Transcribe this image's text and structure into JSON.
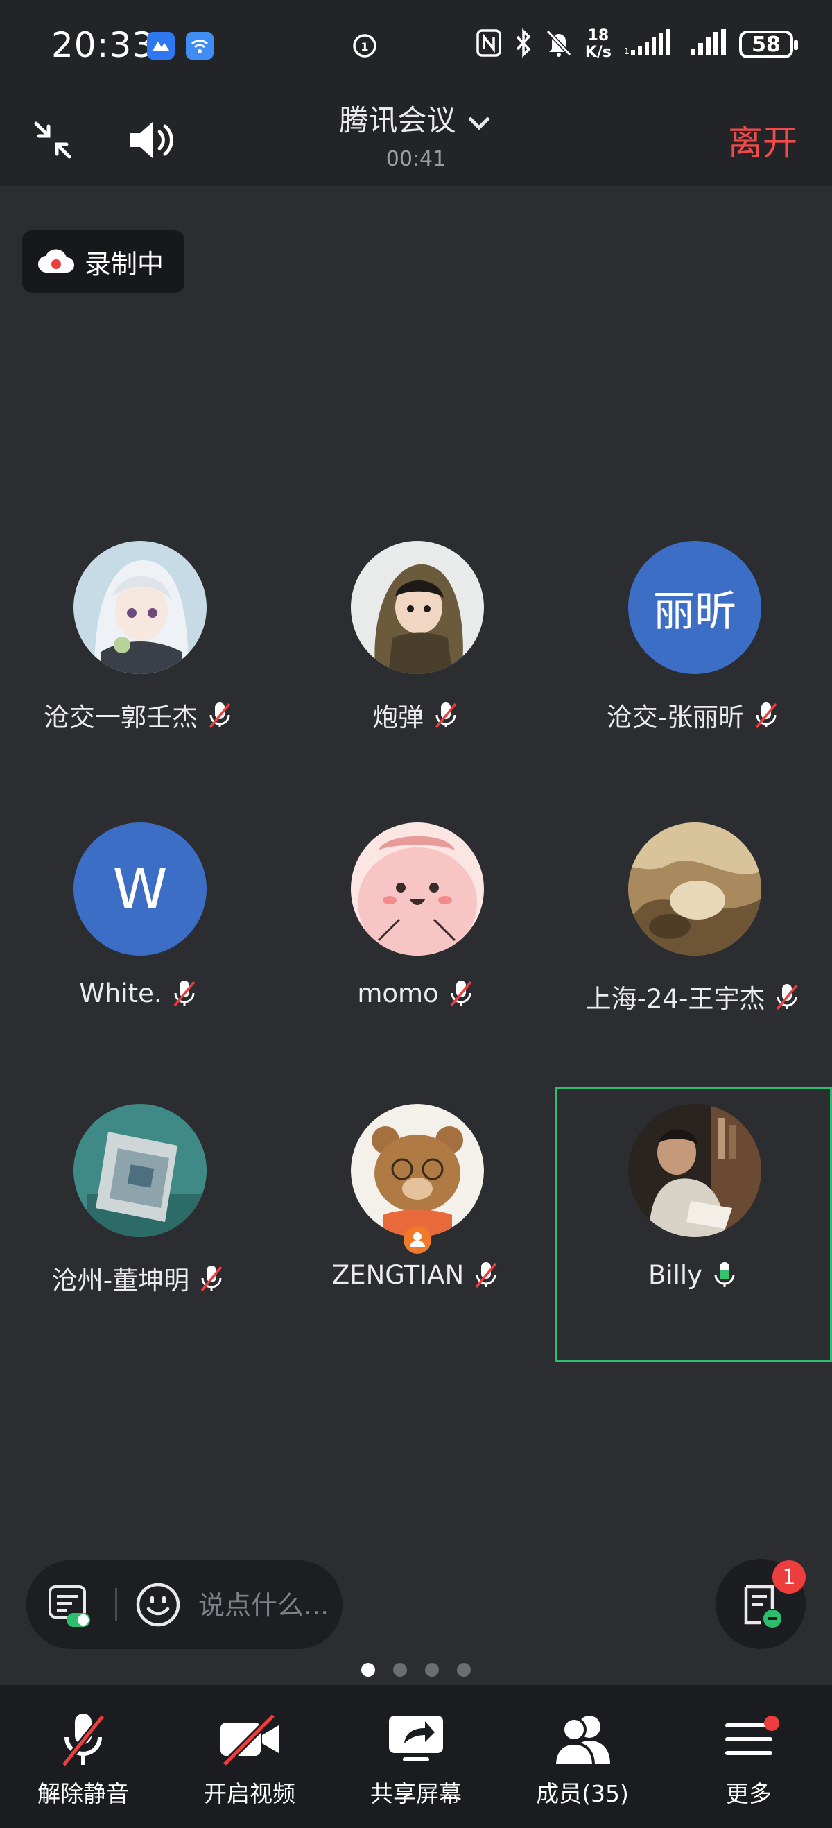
{
  "status_bar": {
    "time": "20:33",
    "net_speed_value": "18",
    "net_speed_unit": "K/s",
    "battery": "58"
  },
  "header": {
    "title": "腾讯会议",
    "timer": "00:41",
    "leave_label": "离开"
  },
  "recording": {
    "label": "录制中"
  },
  "participants": [
    {
      "name": "沧交一郭壬杰",
      "initials": "",
      "muted": true
    },
    {
      "name": "炮弹",
      "initials": "",
      "muted": true
    },
    {
      "name": "沧交-张丽昕",
      "initials": "丽昕",
      "muted": true
    },
    {
      "name": "White.",
      "initials": "W",
      "muted": true
    },
    {
      "name": "momo",
      "initials": "",
      "muted": true
    },
    {
      "name": "上海-24-王宇杰",
      "initials": "",
      "muted": true
    },
    {
      "name": "沧州-董坤明",
      "initials": "",
      "muted": true
    },
    {
      "name": "ZENGTIAN",
      "initials": "",
      "muted": true
    },
    {
      "name": "Billy",
      "initials": "",
      "muted": false
    }
  ],
  "chat": {
    "placeholder": "说点什么..."
  },
  "notes": {
    "badge": "1"
  },
  "pages": {
    "count": 4,
    "current": 1
  },
  "toolbar": {
    "unmute": "解除静音",
    "video": "开启视频",
    "share": "共享屏幕",
    "members": "成员(35)",
    "more": "更多"
  },
  "colors": {
    "background": "#2b2d31",
    "leave": "#f04b4b",
    "speaking_border": "#2dbd6e",
    "initials_avatar": "#3d6ec5",
    "badge": "#ee3d3d"
  }
}
